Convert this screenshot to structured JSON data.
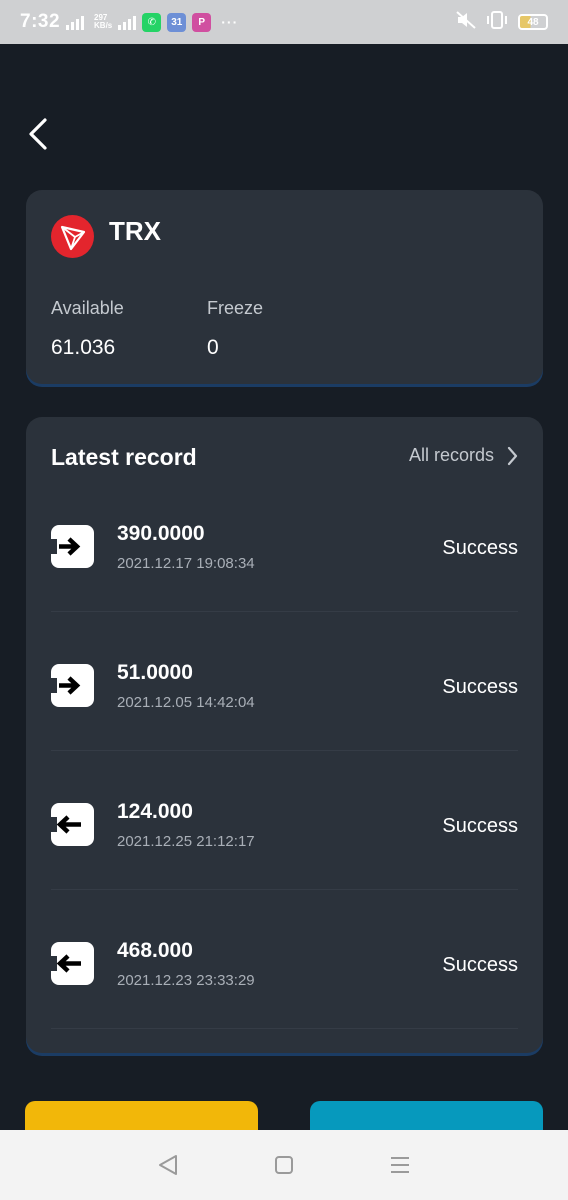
{
  "status_bar": {
    "time": "7:32",
    "network_speed_top": "297",
    "network_speed_unit": "KB/s",
    "battery": "48",
    "app_icons": [
      {
        "name": "whatsapp-icon",
        "glyph": "✆",
        "color": "#25d366"
      },
      {
        "name": "calendar-icon",
        "glyph": "31",
        "color": "#6d8fd6"
      },
      {
        "name": "p-app-icon",
        "glyph": "P",
        "color": "#d04fa0"
      }
    ],
    "dots": "···"
  },
  "asset": {
    "coin": "TRX",
    "available_label": "Available",
    "available_value": "61.036",
    "freeze_label": "Freeze",
    "freeze_value": "0",
    "logo_color": "#e3252d"
  },
  "records": {
    "title": "Latest record",
    "all_label": "All records",
    "items": [
      {
        "amount": "390.0000",
        "time": "2021.12.17 19:08:34",
        "status": "Success",
        "direction": "in"
      },
      {
        "amount": "51.0000",
        "time": "2021.12.05 14:42:04",
        "status": "Success",
        "direction": "in"
      },
      {
        "amount": "124.000",
        "time": "2021.12.25 21:12:17",
        "status": "Success",
        "direction": "out"
      },
      {
        "amount": "468.000",
        "time": "2021.12.23 23:33:29",
        "status": "Success",
        "direction": "out"
      }
    ]
  },
  "colors": {
    "background": "#171d25",
    "card": "#2b323b",
    "button_primary": "#f2b709",
    "button_secondary": "#0699bd"
  }
}
